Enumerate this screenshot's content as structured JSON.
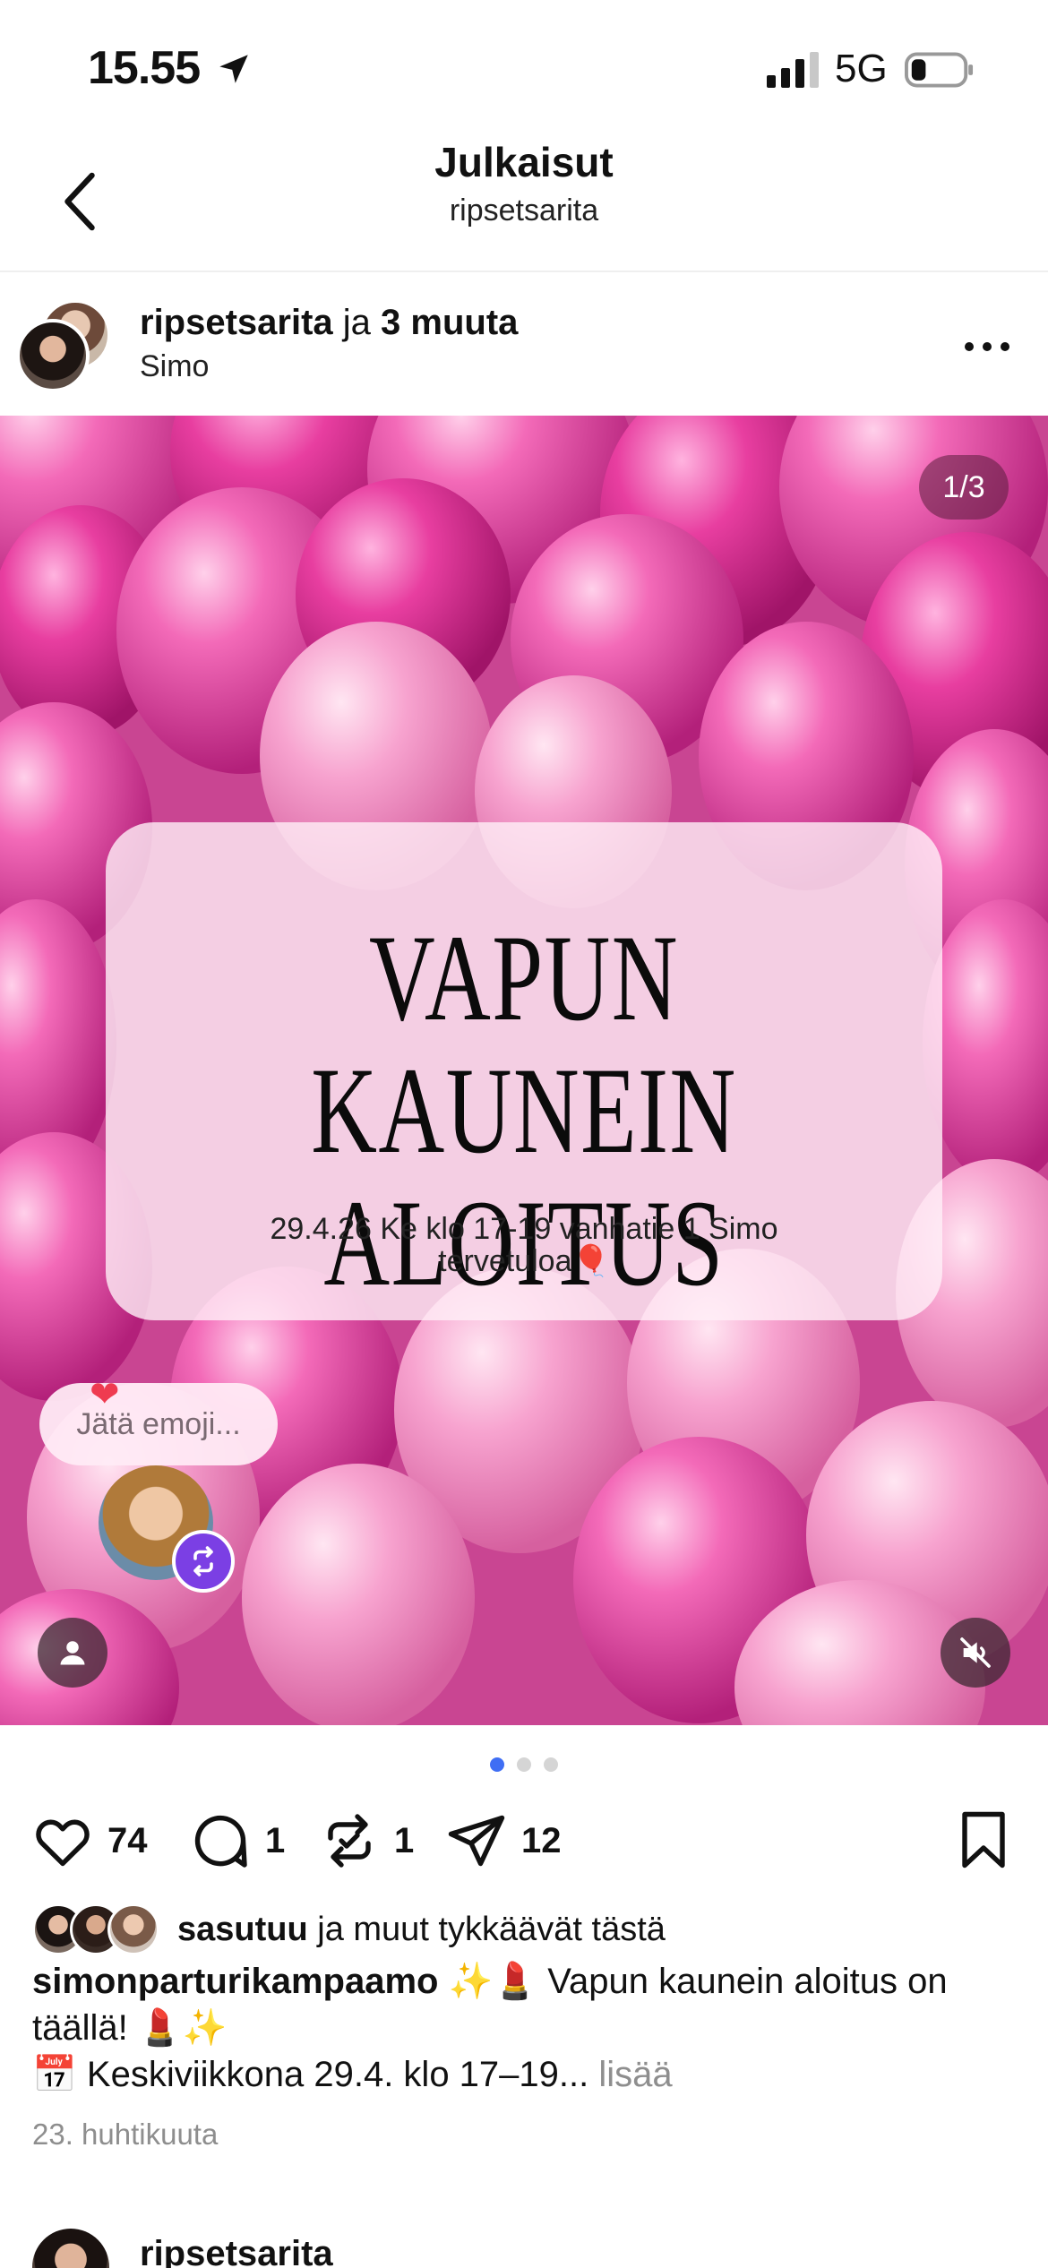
{
  "status_bar": {
    "time": "15.55",
    "network": "5G"
  },
  "header": {
    "title": "Julkaisut",
    "subtitle": "ripsetsarita"
  },
  "post": {
    "author_primary": "ripsetsarita",
    "author_connector": " ja ",
    "author_others": "3 muuta",
    "location": "Simo",
    "page_counter": "1/3",
    "card_title_line1": "VAPUN KAUNEIN",
    "card_title_line2": "ALOITUS",
    "card_sub_line1": "29.4.26 Ke klo 17-19 vanhatie 1 Simo",
    "card_sub_line2": "tervetuloa🎈",
    "emoji_prompt": "Jätä emoji...",
    "heart_emoji": "❤",
    "like_count": "74",
    "comment_count": "1",
    "repost_count": "1",
    "share_count": "12",
    "liked_by_user": "sasutuu",
    "liked_by_rest": " ja muut tykkäävät tästä",
    "caption_user": "simonparturikampaamo",
    "caption_line1": " ✨💄 Vapun kaunein aloitus on täällä! 💄✨",
    "caption_line2": "📅 Keskiviikkona 29.4. klo 17–19...",
    "caption_more": " lisää",
    "date": "23. huhtikuuta"
  },
  "next_post": {
    "author": "ripsetsarita"
  },
  "colors": {
    "accent_blue": "#3f6ef4",
    "repost_purple": "#7b3fe4",
    "balloon_pink": "#d85aa6"
  },
  "icons": [
    "location-arrow-icon",
    "signal-icon",
    "battery-icon",
    "back-chevron-icon",
    "more-dots-icon",
    "heart-icon",
    "comment-icon",
    "repost-icon",
    "send-icon",
    "bookmark-icon",
    "user-tag-icon",
    "mute-icon"
  ]
}
